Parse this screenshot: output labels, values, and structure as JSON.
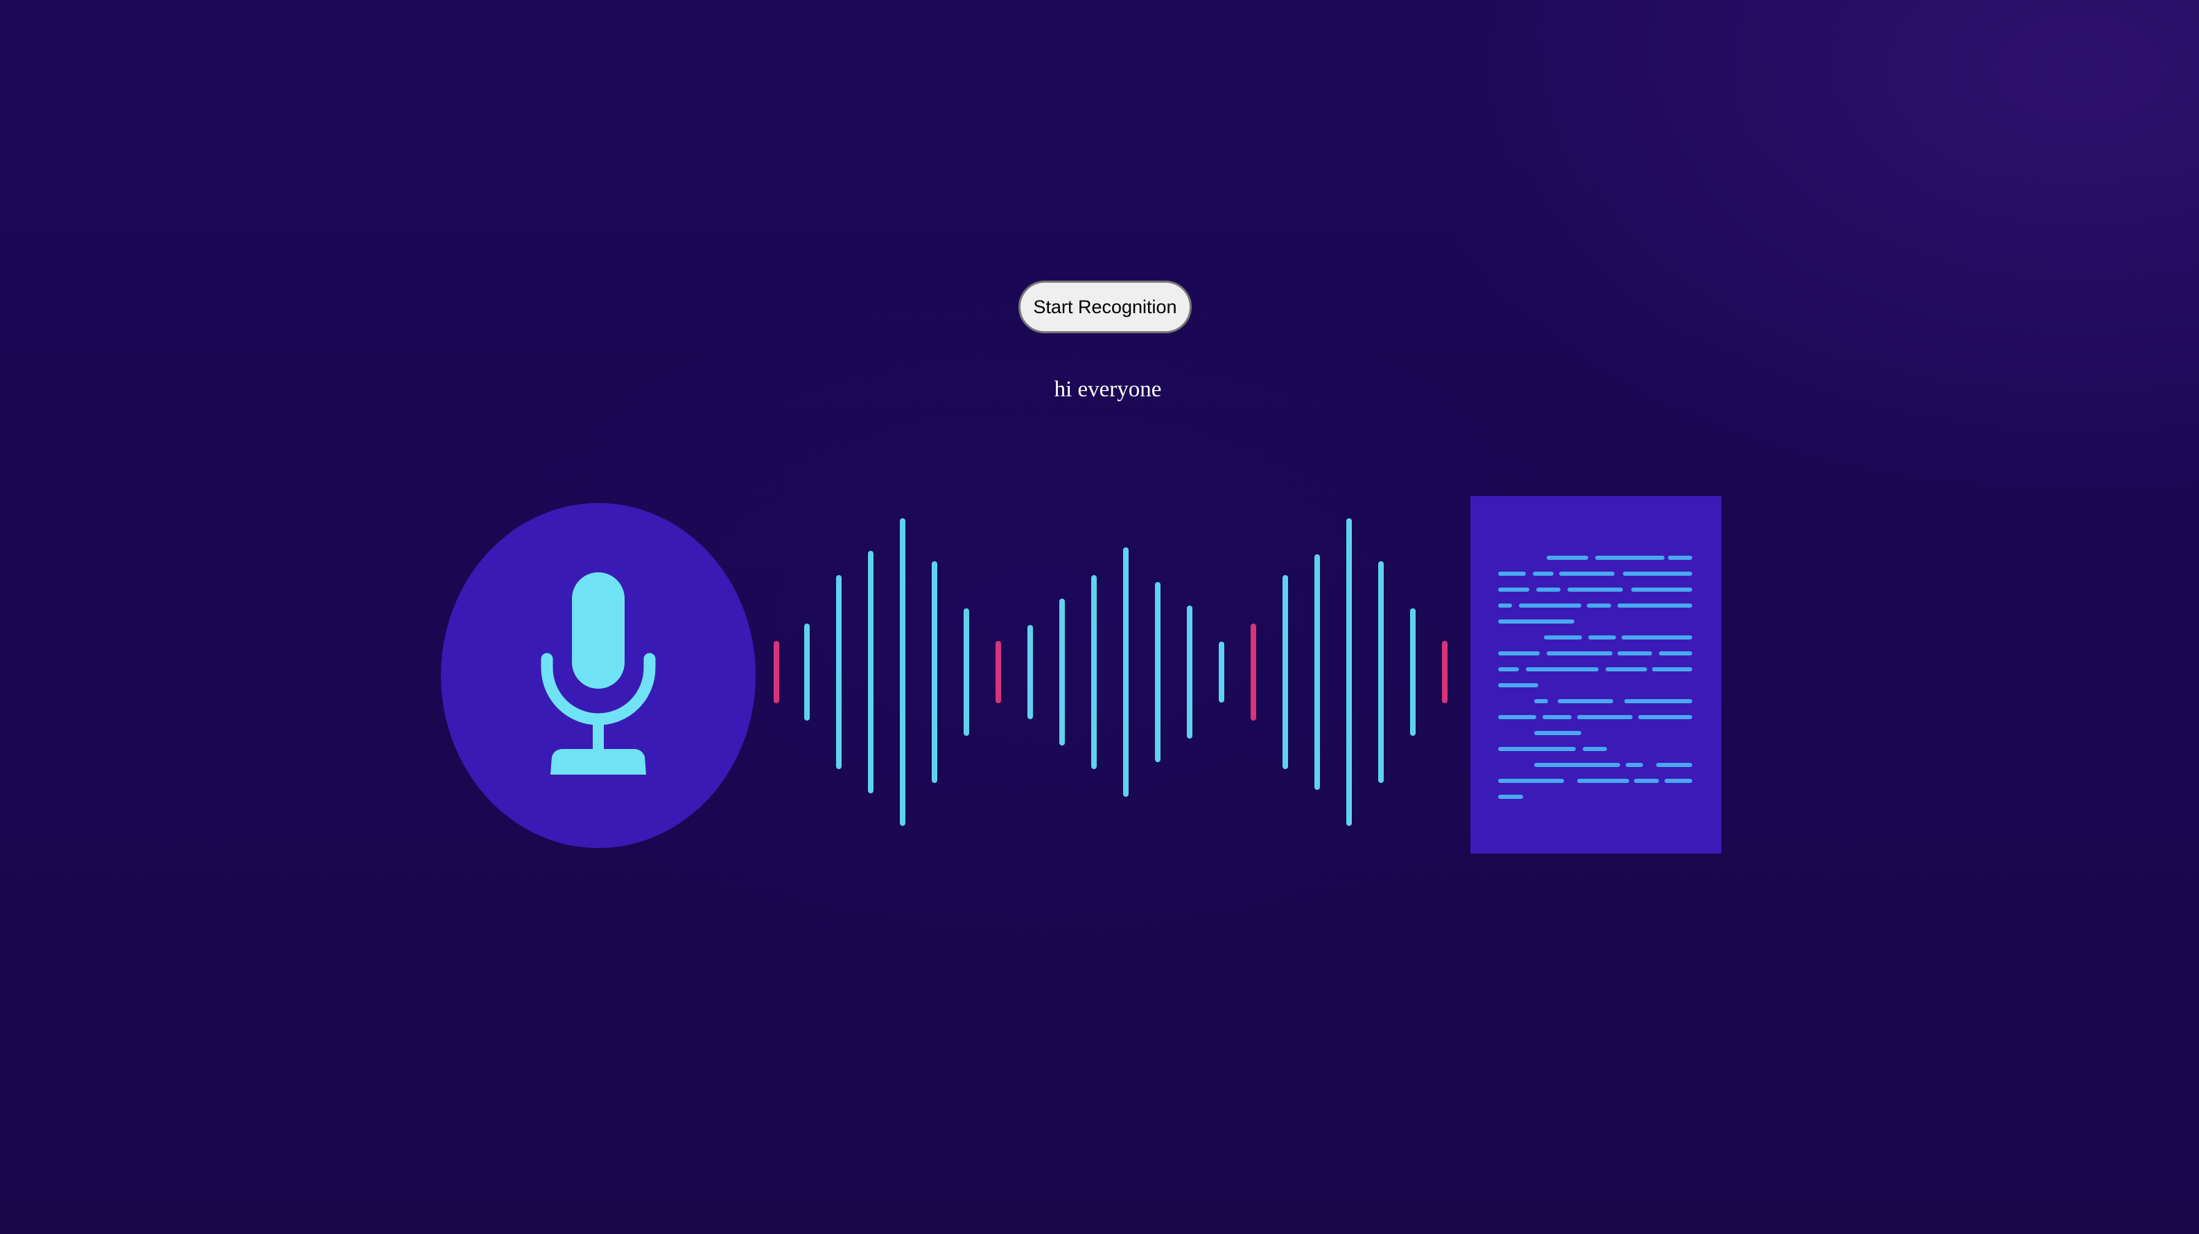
{
  "app": {
    "start_button_label": "Start Recognition",
    "transcript_text": "hi everyone"
  },
  "illustration": {
    "microphone_icon": "microphone-icon",
    "waveform_icon": "sound-wave",
    "document_icon": "text-document-icon",
    "colors": {
      "background": "#1b0753",
      "circle": "#3a1ab5",
      "mic": "#6fe3f5",
      "wave_primary": "#5fd3ee",
      "wave_accent": "#d8347a",
      "document": "#3b1ab8",
      "document_lines": "#4aa8f0"
    }
  }
}
